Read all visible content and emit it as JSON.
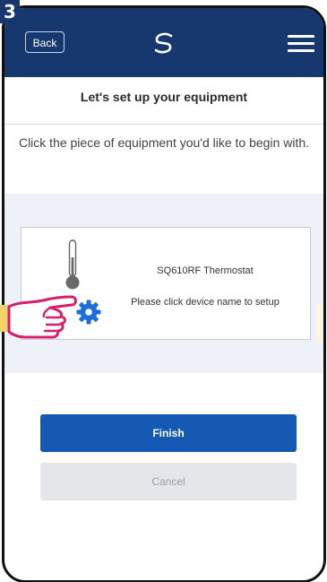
{
  "step": {
    "number": "3"
  },
  "header": {
    "back_label": "Back",
    "logo_icon": "salus-swoosh-logo",
    "menu_icon": "hamburger-menu-icon",
    "bar_color": "#16386e"
  },
  "page": {
    "title": "Let's set up your equipment",
    "instruction": "Click the piece of equipment you'd like to begin with."
  },
  "device": {
    "name": "SQ610RF Thermostat",
    "hint": "Please click device name to setup",
    "icons": [
      "thermometer-icon",
      "gear-icon"
    ]
  },
  "overlay": {
    "pointer_icon": "pointing-hand-icon",
    "pointer_color": "#d61f6e"
  },
  "actions": {
    "finish_label": "Finish",
    "cancel_label": "Cancel",
    "finish_color": "#1659b5"
  }
}
